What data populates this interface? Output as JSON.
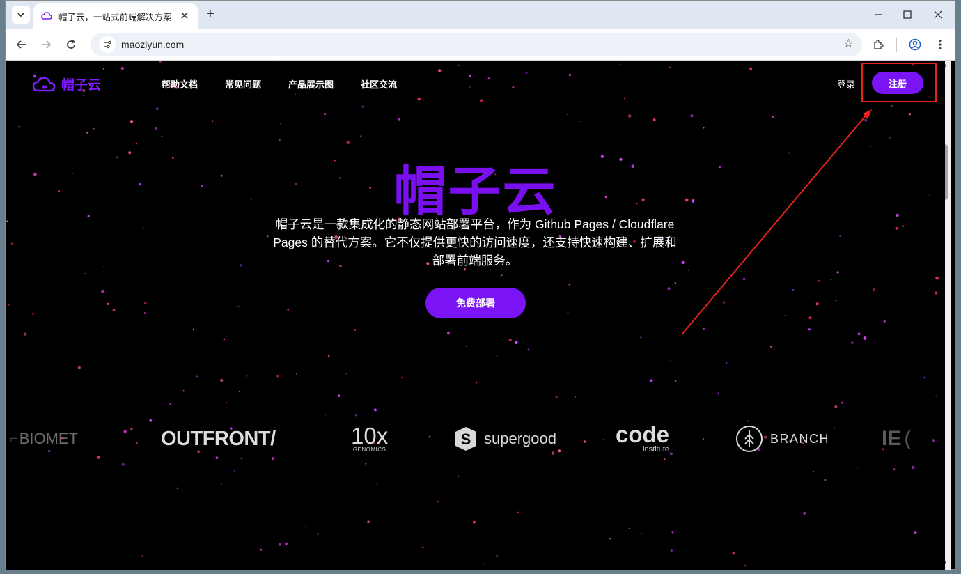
{
  "browser": {
    "tab_title": "帽子云，一站式前端解决方案",
    "new_tab": "+",
    "url": "maoziyun.com"
  },
  "site": {
    "logo_text": "帽子云",
    "nav": [
      "帮助文档",
      "常见问题",
      "产品展示图",
      "社区交流"
    ],
    "login": "登录",
    "signup": "注册",
    "hero_title": "帽子云",
    "hero_desc": "帽子云是一款集成化的静态网站部署平台，作为 Github Pages / Cloudflare Pages 的替代方案。它不仅提供更快的访问速度，还支持快速构建、扩展和部署前端服务。",
    "cta": "免费部署",
    "brands": {
      "biomet": "BIOMET",
      "outfront": "OUTFRONT/",
      "tenx_main": "10x",
      "tenx_sub": "GENOMICS",
      "supergood": "supergood",
      "code_main": "code",
      "code_sub": "institute",
      "branch": "BRANCH",
      "partial": "IE"
    }
  },
  "colors": {
    "brand_purple": "#7a14f5",
    "annotation_red": "#e8231c"
  }
}
